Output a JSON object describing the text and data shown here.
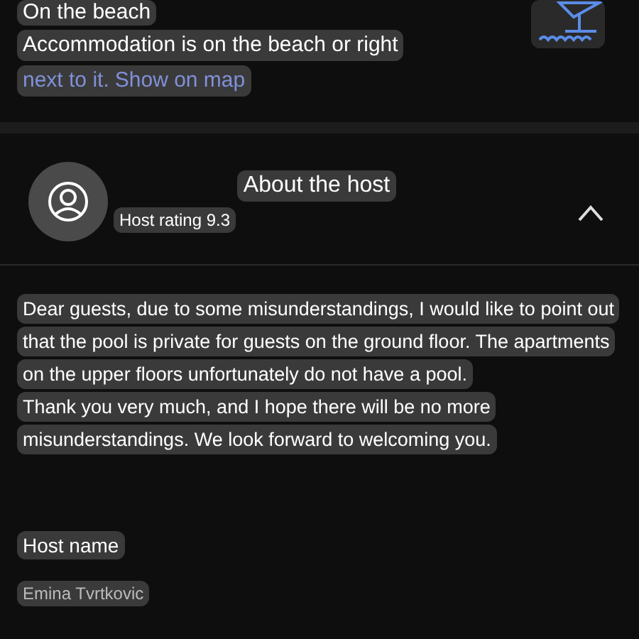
{
  "beach": {
    "title": "On the beach",
    "description": "Accommodation is on the beach or right",
    "description_cont": "next to it.",
    "map_link": "Show on map"
  },
  "host": {
    "title": "About the host",
    "rating": "Host rating 9.3",
    "expanded": true,
    "message_lines": [
      "Dear guests, due to some misunderstandings, I would like to point out",
      "that the pool is private for guests on the ground floor. The apartments",
      "on the upper floors unfortunately do not have a pool.",
      "Thank you very much, and I hope there will be no more",
      "misunderstandings. We look forward to welcoming you."
    ],
    "name_label": "Host name",
    "name": "Emina Tvrtkovic"
  }
}
